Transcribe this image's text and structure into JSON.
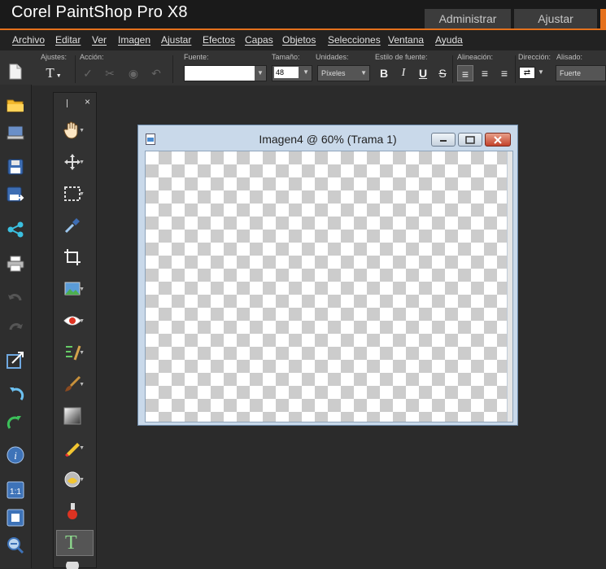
{
  "app": {
    "title": "Corel PaintShop Pro X8"
  },
  "workspace_tabs": {
    "admin": "Administrar",
    "adjust": "Ajustar"
  },
  "menu": [
    "Archivo",
    "Editar",
    "Ver",
    "Imagen",
    "Ajustar",
    "Efectos",
    "Capas",
    "Objetos",
    "Selecciones",
    "Ventana",
    "Ayuda"
  ],
  "options": {
    "presets_label": "Ajustes:",
    "action_label": "Acción:",
    "font_label": "Fuente:",
    "font_value": "",
    "size_label": "Tamaño:",
    "size_value": "48",
    "units_label": "Unidades:",
    "units_value": "Píxeles",
    "style_label": "Estilo de fuente:",
    "align_label": "Alineación:",
    "direction_label": "Dirección:",
    "antialias_label": "Alisado:",
    "antialias_value": "Fuerte",
    "bold": "B",
    "italic": "I",
    "underline": "U",
    "strike": "S"
  },
  "document": {
    "title": "Imagen4 @  60% (Trama 1)"
  },
  "tools": {
    "grip": "I",
    "close": "×",
    "text_tool_glyph": "T"
  },
  "colors": {
    "accent": "#e5711c",
    "background": "#2b2b2b"
  }
}
